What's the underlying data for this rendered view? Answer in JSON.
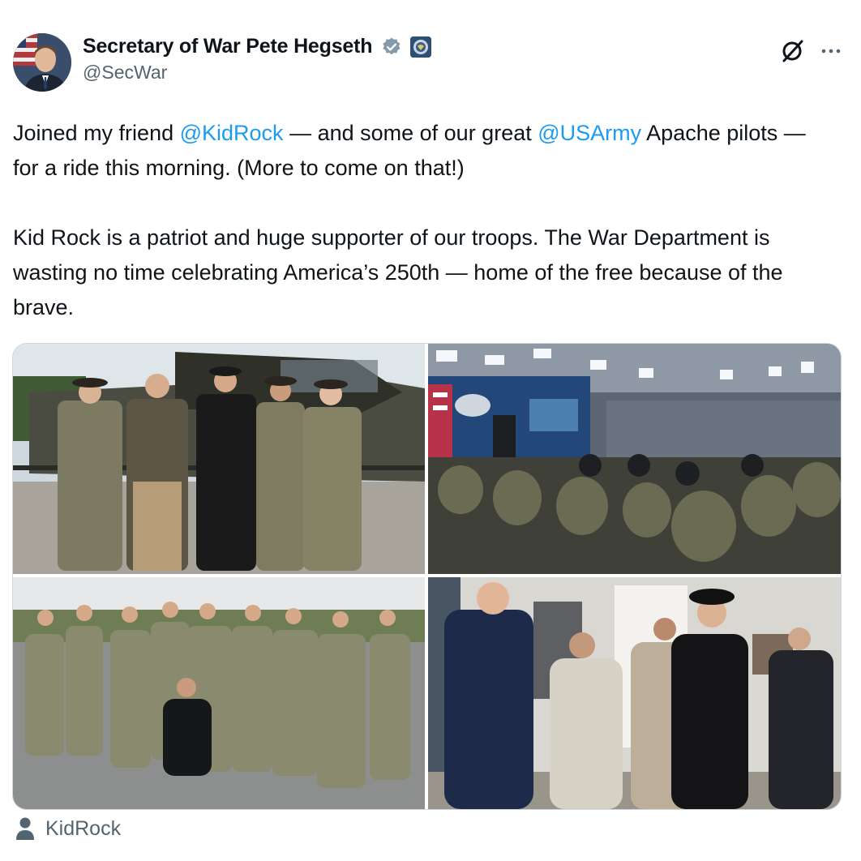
{
  "author": {
    "display_name": "Secretary of War Pete Hegseth",
    "handle": "@SecWar",
    "verified_badge_color": "#829aab",
    "avatar_icon": "profile-photo"
  },
  "header": {
    "grok_icon": "grok-icon",
    "more_icon": "more-icon"
  },
  "tweet": {
    "p1_a": "Joined my friend ",
    "p1_mention1": "@KidRock",
    "p1_b": " — and some of our great ",
    "p1_mention2": "@USArmy",
    "p1_c": " Apache pilots — for a ride this morning. (More to come on that!)",
    "p2": "Kid Rock is a patriot and huge supporter of our troops. The War Department is wasting no time celebrating America’s 250th — home of the free because of the brave."
  },
  "media": {
    "photos": [
      "photo-group-apache-helicopter",
      "photo-press-briefing-room",
      "photo-group-soldiers-outdoors",
      "photo-hallway-greeting"
    ]
  },
  "tagged": {
    "label": "KidRock",
    "icon": "person-icon"
  },
  "colors": {
    "link": "#1d9bf0",
    "secondary_text": "#536471",
    "border": "#cfd9de"
  }
}
